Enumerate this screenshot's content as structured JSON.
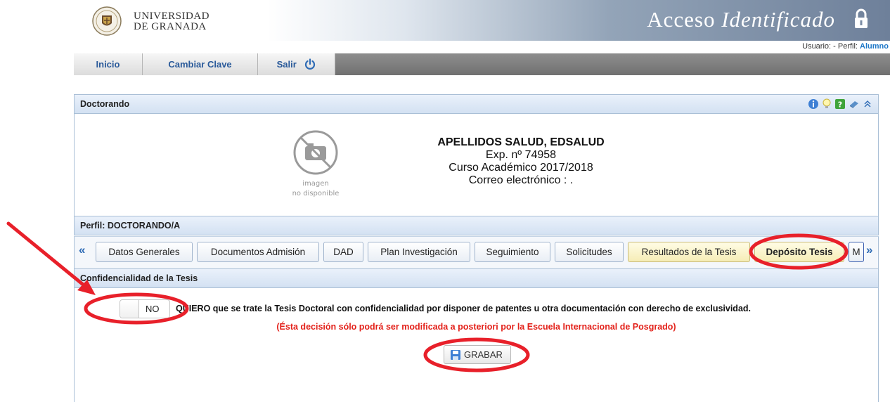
{
  "header": {
    "university_line1": "UNIVERSIDAD",
    "university_line2": "DE GRANADA",
    "title_part1": "Acceso ",
    "title_part2": "Identificado",
    "user_label": "Usuario: - Perfil:",
    "user_profile": "Alumno"
  },
  "nav": {
    "inicio": "Inicio",
    "cambiar_clave": "Cambiar Clave",
    "salir": "Salir"
  },
  "doctorando": {
    "panel_title": "Doctorando",
    "photo_line1": "imagen",
    "photo_line2": "no disponible",
    "name": "APELLIDOS SALUD, EDSALUD",
    "expediente": "Exp. nº 74958",
    "curso": "Curso Académico 2017/2018",
    "correo": "Correo electrónico : ."
  },
  "perfil": {
    "title": "Perfil: DOCTORANDO/A"
  },
  "tabs": {
    "prev": "«",
    "next": "»",
    "items": [
      {
        "label": "Datos Generales"
      },
      {
        "label": "Documentos Admisión"
      },
      {
        "label": "DAD"
      },
      {
        "label": "Plan Investigación"
      },
      {
        "label": "Seguimiento"
      },
      {
        "label": "Solicitudes"
      },
      {
        "label": "Resultados de la Tesis"
      },
      {
        "label": "Depósito Tesis"
      },
      {
        "label": "M"
      }
    ]
  },
  "confidencialidad": {
    "title": "Confidencialidad de la Tesis",
    "toggle_value": "NO",
    "statement": "QUIERO que se trate la Tesis Doctoral con confidencialidad por disponer de patentes u otra documentación con derecho de exclusividad.",
    "note": "(Ésta decisión sólo podrá ser modificada a posteriori por la Escuela Internacional de Posgrado)",
    "save_label": "GRABAR"
  },
  "colors": {
    "accent_blue": "#2e6bb5",
    "annotation_red": "#e8202a",
    "note_red": "#e3221b"
  }
}
